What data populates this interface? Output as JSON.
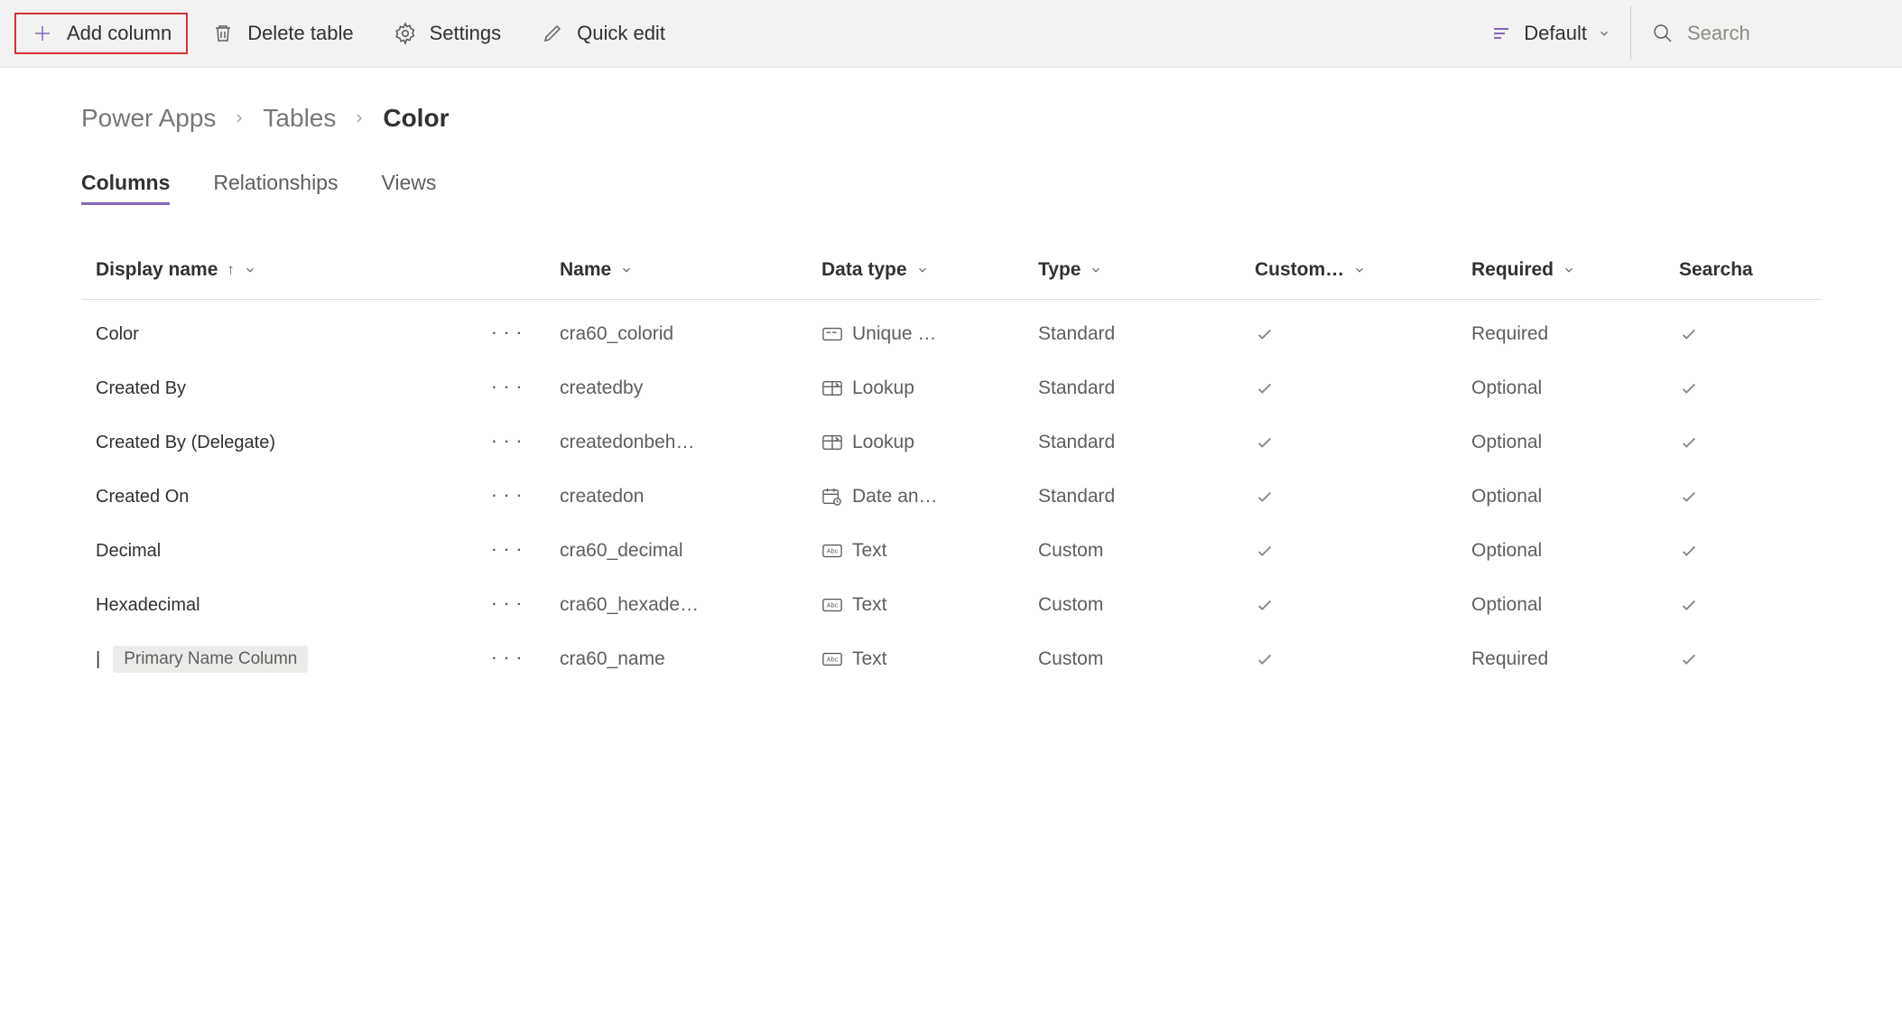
{
  "toolbar": {
    "add_column": "Add column",
    "delete_table": "Delete table",
    "settings": "Settings",
    "quick_edit": "Quick edit",
    "view_label": "Default",
    "search_placeholder": "Search"
  },
  "breadcrumb": {
    "root": "Power Apps",
    "parent": "Tables",
    "current": "Color"
  },
  "tabs": {
    "columns": "Columns",
    "relationships": "Relationships",
    "views": "Views"
  },
  "table": {
    "headers": {
      "display_name": "Display name",
      "name": "Name",
      "data_type": "Data type",
      "type": "Type",
      "customizable": "Custom…",
      "required": "Required",
      "searchable": "Searcha"
    },
    "rows": [
      {
        "display": "Color",
        "name": "cra60_colorid",
        "data_type": "Unique …",
        "type_icon": "unique",
        "type": "Standard",
        "custom": true,
        "required": "Required",
        "searchable": true,
        "badge": null
      },
      {
        "display": "Created By",
        "name": "createdby",
        "data_type": "Lookup",
        "type_icon": "lookup",
        "type": "Standard",
        "custom": true,
        "required": "Optional",
        "searchable": true,
        "badge": null
      },
      {
        "display": "Created By (Delegate)",
        "name": "createdonbeh…",
        "data_type": "Lookup",
        "type_icon": "lookup",
        "type": "Standard",
        "custom": true,
        "required": "Optional",
        "searchable": true,
        "badge": null
      },
      {
        "display": "Created On",
        "name": "createdon",
        "data_type": "Date an…",
        "type_icon": "datetime",
        "type": "Standard",
        "custom": true,
        "required": "Optional",
        "searchable": true,
        "badge": null
      },
      {
        "display": "Decimal",
        "name": "cra60_decimal",
        "data_type": "Text",
        "type_icon": "text",
        "type": "Custom",
        "custom": true,
        "required": "Optional",
        "searchable": true,
        "badge": null
      },
      {
        "display": "Hexadecimal",
        "name": "cra60_hexade…",
        "data_type": "Text",
        "type_icon": "text",
        "type": "Custom",
        "custom": true,
        "required": "Optional",
        "searchable": true,
        "badge": null
      },
      {
        "display": "",
        "name": "cra60_name",
        "data_type": "Text",
        "type_icon": "text",
        "type": "Custom",
        "custom": true,
        "required": "Required",
        "searchable": true,
        "badge": "Primary Name Column"
      }
    ]
  }
}
